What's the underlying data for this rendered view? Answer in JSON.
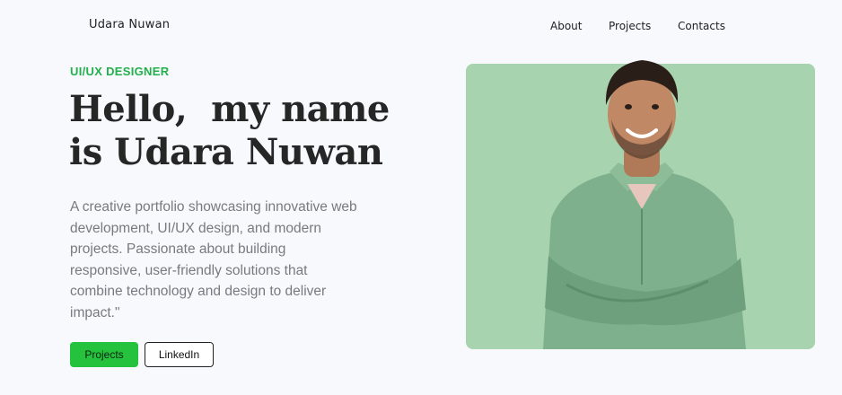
{
  "header": {
    "logo": "Udara Nuwan",
    "nav": [
      {
        "label": "About"
      },
      {
        "label": "Projects"
      },
      {
        "label": "Contacts"
      }
    ]
  },
  "hero": {
    "eyebrow": "UI/UX DESIGNER",
    "headline_line1": "Hello,  my name",
    "headline_line2": "is Udara Nuwan",
    "description": "A creative portfolio showcasing innovative web development, UI/UX design, and modern projects. Passionate about building responsive, user-friendly solutions that combine technology and design to deliver impact.\"",
    "primary_button": "Projects",
    "secondary_button": "LinkedIn"
  },
  "colors": {
    "accent": "#22b04b",
    "button_green": "#25c23e",
    "photo_bg": "#a7d4af",
    "page_bg": "#f8f9fd"
  }
}
